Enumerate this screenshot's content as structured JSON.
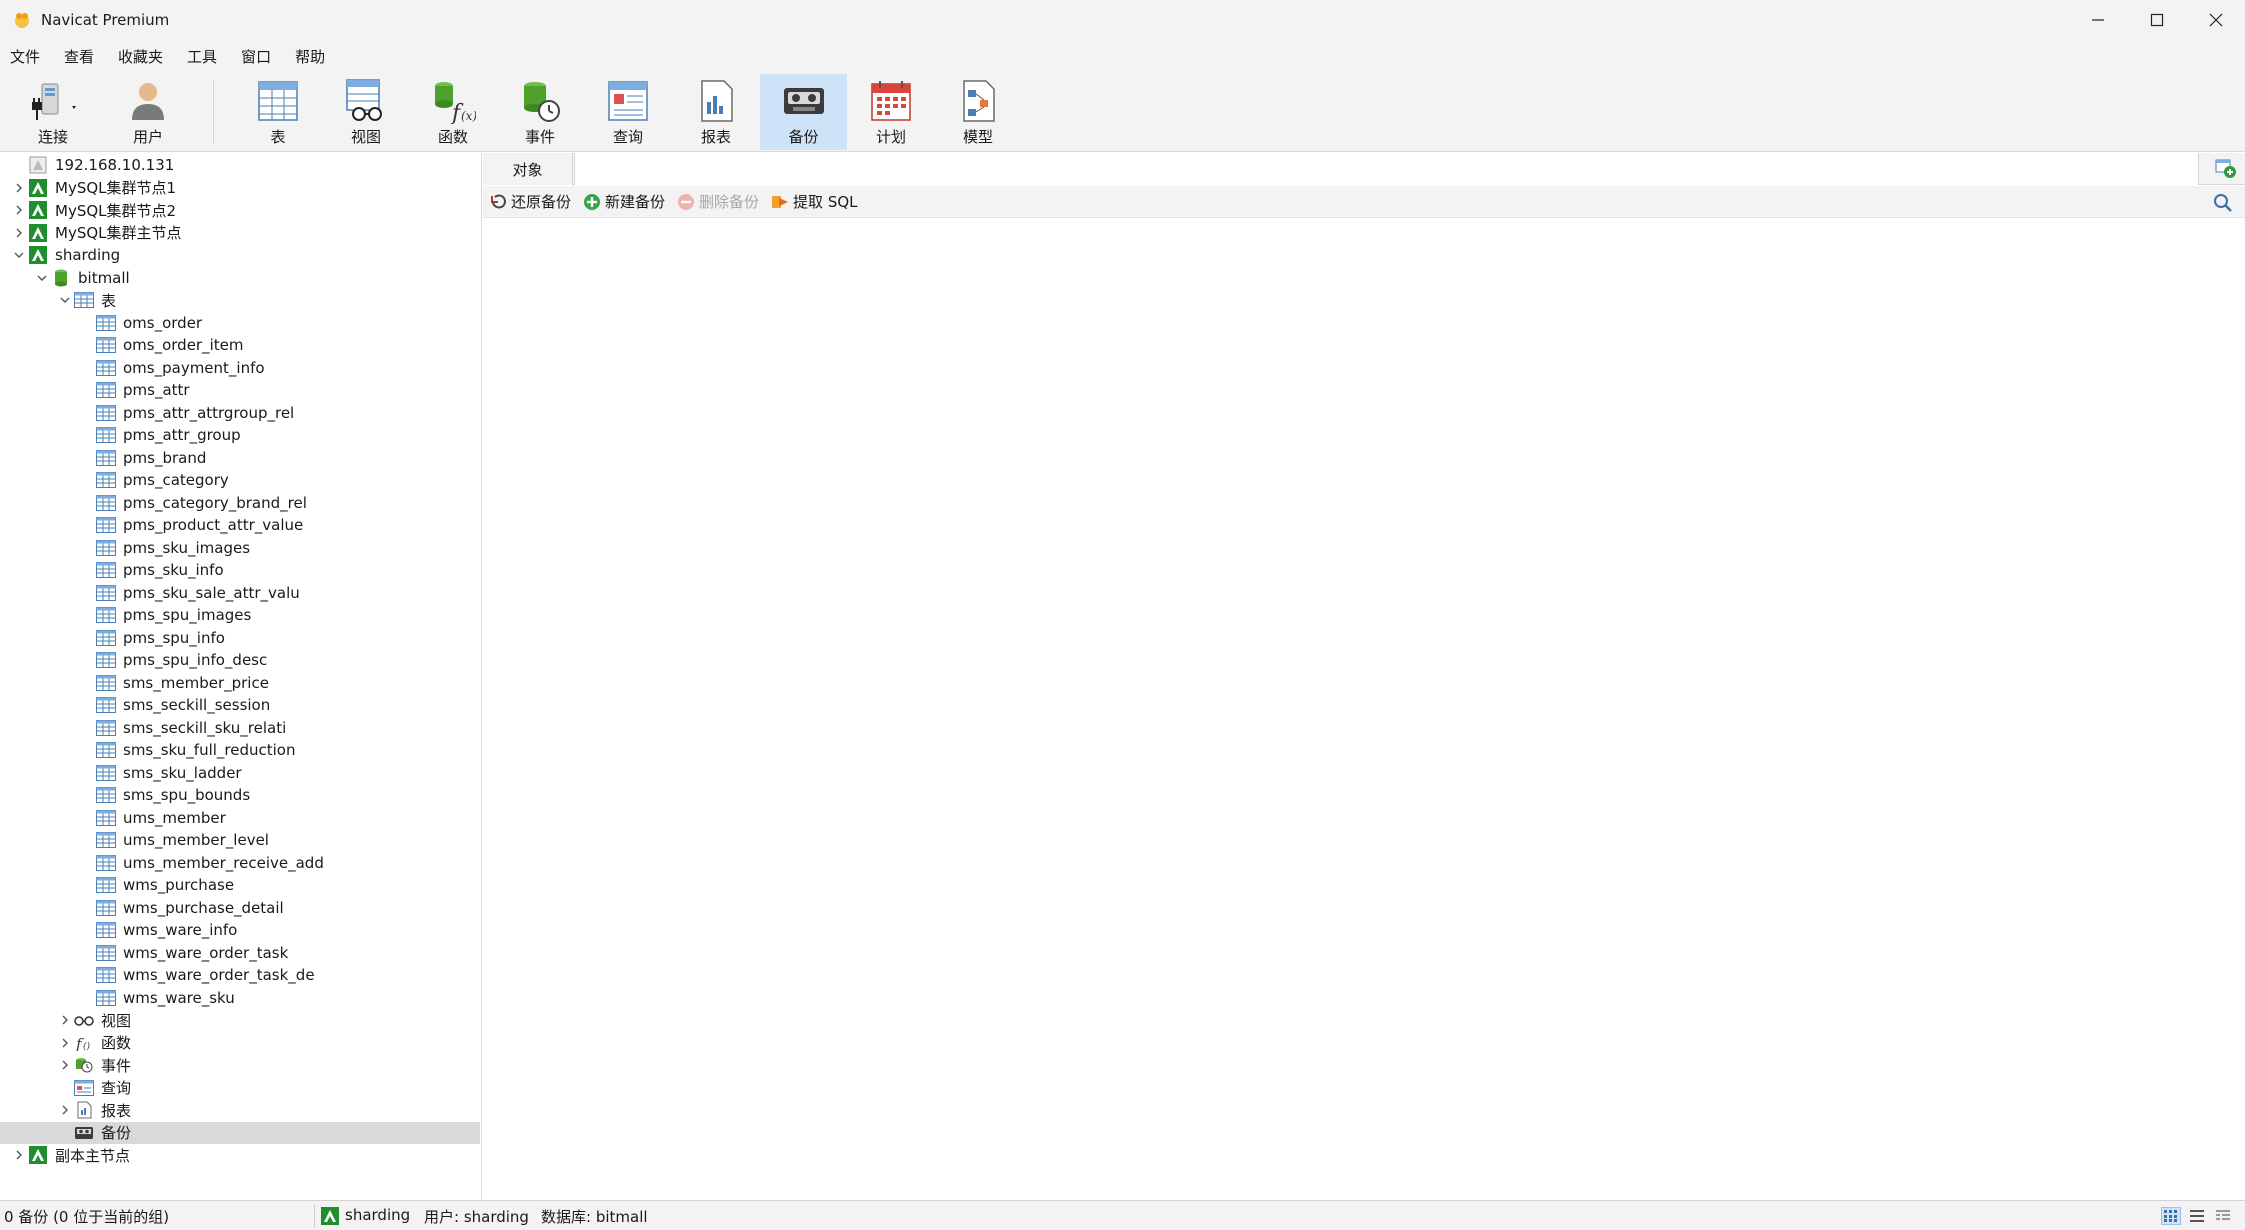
{
  "window": {
    "title": "Navicat Premium"
  },
  "menu": [
    "文件",
    "查看",
    "收藏夹",
    "工具",
    "窗口",
    "帮助"
  ],
  "toolbar": {
    "connect": "连接",
    "user": "用户",
    "table": "表",
    "view": "视图",
    "function": "函数",
    "event": "事件",
    "query": "查询",
    "report": "报表",
    "backup": "备份",
    "schedule": "计划",
    "model": "模型",
    "active": "备份"
  },
  "tree": {
    "connections": [
      {
        "label": "192.168.10.131"
      },
      {
        "label": "MySQL集群节点1"
      },
      {
        "label": "MySQL集群节点2"
      },
      {
        "label": "MySQL集群主节点"
      },
      {
        "label": "sharding"
      }
    ],
    "database": "bitmall",
    "tables_group": "表",
    "tables": [
      "oms_order",
      "oms_order_item",
      "oms_payment_info",
      "pms_attr",
      "pms_attr_attrgroup_rel",
      "pms_attr_group",
      "pms_brand",
      "pms_category",
      "pms_category_brand_rel",
      "pms_product_attr_value",
      "pms_sku_images",
      "pms_sku_info",
      "pms_sku_sale_attr_valu",
      "pms_spu_images",
      "pms_spu_info",
      "pms_spu_info_desc",
      "sms_member_price",
      "sms_seckill_session",
      "sms_seckill_sku_relati",
      "sms_sku_full_reduction",
      "sms_sku_ladder",
      "sms_spu_bounds",
      "ums_member",
      "ums_member_level",
      "ums_member_receive_add",
      "wms_purchase",
      "wms_purchase_detail",
      "wms_ware_info",
      "wms_ware_order_task",
      "wms_ware_order_task_de",
      "wms_ware_sku"
    ],
    "groups": [
      "视图",
      "函数",
      "事件",
      "查询",
      "报表",
      "备份"
    ],
    "selected_group": "备份",
    "last_connection": "副本主节点"
  },
  "tabs": {
    "object": "对象"
  },
  "actions": {
    "restore": "还原备份",
    "new": "新建备份",
    "delete": "删除备份",
    "extract": "提取 SQL"
  },
  "status": {
    "count": "0 备份 (0 位于当前的组)",
    "connection": "sharding",
    "user": "用户: sharding",
    "database": "数据库: bitmall"
  },
  "colors": {
    "chrome": "#f3f3f3",
    "active_tool": "#cfe3f8",
    "selected_row": "#d9d9d9",
    "mysql_green": "#1f8f2e"
  }
}
